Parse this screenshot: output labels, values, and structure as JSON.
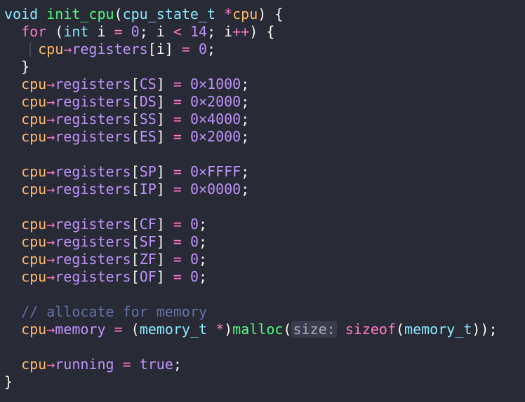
{
  "code": {
    "lines": [
      {
        "indent": "",
        "tokens": [
          {
            "t": "void",
            "k": "type"
          },
          {
            "t": " ",
            "k": "punct"
          },
          {
            "t": "init_cpu",
            "k": "fn"
          },
          {
            "t": "(",
            "k": "punct"
          },
          {
            "t": "cpu_state_t",
            "k": "type"
          },
          {
            "t": " ",
            "k": "punct"
          },
          {
            "t": "*",
            "k": "op"
          },
          {
            "t": "cpu",
            "k": "var"
          },
          {
            "t": ") {",
            "k": "punct"
          }
        ]
      },
      {
        "indent": "  ",
        "tokens": [
          {
            "t": "for",
            "k": "kw"
          },
          {
            "t": " (",
            "k": "punct"
          },
          {
            "t": "int",
            "k": "type"
          },
          {
            "t": " i ",
            "k": "punct"
          },
          {
            "t": "=",
            "k": "op"
          },
          {
            "t": " ",
            "k": "punct"
          },
          {
            "t": "0",
            "k": "num"
          },
          {
            "t": "; i ",
            "k": "punct"
          },
          {
            "t": "<",
            "k": "op"
          },
          {
            "t": " ",
            "k": "punct"
          },
          {
            "t": "14",
            "k": "num"
          },
          {
            "t": "; i",
            "k": "punct"
          },
          {
            "t": "++",
            "k": "op"
          },
          {
            "t": ") {",
            "k": "punct"
          }
        ]
      },
      {
        "indent": "    ",
        "guide": true,
        "tokens": [
          {
            "t": "cpu",
            "k": "var"
          },
          {
            "t": "→",
            "k": "op"
          },
          {
            "t": "registers",
            "k": "field"
          },
          {
            "t": "[i] ",
            "k": "punct"
          },
          {
            "t": "=",
            "k": "op"
          },
          {
            "t": " ",
            "k": "punct"
          },
          {
            "t": "0",
            "k": "num"
          },
          {
            "t": ";",
            "k": "punct"
          }
        ]
      },
      {
        "indent": "  ",
        "tokens": [
          {
            "t": "}",
            "k": "punct"
          }
        ]
      },
      {
        "indent": "  ",
        "tokens": [
          {
            "t": "cpu",
            "k": "var"
          },
          {
            "t": "→",
            "k": "op"
          },
          {
            "t": "registers",
            "k": "field"
          },
          {
            "t": "[",
            "k": "punct"
          },
          {
            "t": "CS",
            "k": "field"
          },
          {
            "t": "] ",
            "k": "punct"
          },
          {
            "t": "=",
            "k": "op"
          },
          {
            "t": " ",
            "k": "punct"
          },
          {
            "t": "0×1000",
            "k": "num"
          },
          {
            "t": ";",
            "k": "punct"
          }
        ]
      },
      {
        "indent": "  ",
        "tokens": [
          {
            "t": "cpu",
            "k": "var"
          },
          {
            "t": "→",
            "k": "op"
          },
          {
            "t": "registers",
            "k": "field"
          },
          {
            "t": "[",
            "k": "punct"
          },
          {
            "t": "DS",
            "k": "field"
          },
          {
            "t": "] ",
            "k": "punct"
          },
          {
            "t": "=",
            "k": "op"
          },
          {
            "t": " ",
            "k": "punct"
          },
          {
            "t": "0×2000",
            "k": "num"
          },
          {
            "t": ";",
            "k": "punct"
          }
        ]
      },
      {
        "indent": "  ",
        "tokens": [
          {
            "t": "cpu",
            "k": "var"
          },
          {
            "t": "→",
            "k": "op"
          },
          {
            "t": "registers",
            "k": "field"
          },
          {
            "t": "[",
            "k": "punct"
          },
          {
            "t": "SS",
            "k": "field"
          },
          {
            "t": "] ",
            "k": "punct"
          },
          {
            "t": "=",
            "k": "op"
          },
          {
            "t": " ",
            "k": "punct"
          },
          {
            "t": "0×4000",
            "k": "num"
          },
          {
            "t": ";",
            "k": "punct"
          }
        ]
      },
      {
        "indent": "  ",
        "tokens": [
          {
            "t": "cpu",
            "k": "var"
          },
          {
            "t": "→",
            "k": "op"
          },
          {
            "t": "registers",
            "k": "field"
          },
          {
            "t": "[",
            "k": "punct"
          },
          {
            "t": "ES",
            "k": "field"
          },
          {
            "t": "] ",
            "k": "punct"
          },
          {
            "t": "=",
            "k": "op"
          },
          {
            "t": " ",
            "k": "punct"
          },
          {
            "t": "0×2000",
            "k": "num"
          },
          {
            "t": ";",
            "k": "punct"
          }
        ]
      },
      {
        "indent": "",
        "tokens": []
      },
      {
        "indent": "  ",
        "tokens": [
          {
            "t": "cpu",
            "k": "var"
          },
          {
            "t": "→",
            "k": "op"
          },
          {
            "t": "registers",
            "k": "field"
          },
          {
            "t": "[",
            "k": "punct"
          },
          {
            "t": "SP",
            "k": "field"
          },
          {
            "t": "] ",
            "k": "punct"
          },
          {
            "t": "=",
            "k": "op"
          },
          {
            "t": " ",
            "k": "punct"
          },
          {
            "t": "0×FFFF",
            "k": "num"
          },
          {
            "t": ";",
            "k": "punct"
          }
        ]
      },
      {
        "indent": "  ",
        "tokens": [
          {
            "t": "cpu",
            "k": "var"
          },
          {
            "t": "→",
            "k": "op"
          },
          {
            "t": "registers",
            "k": "field"
          },
          {
            "t": "[",
            "k": "punct"
          },
          {
            "t": "IP",
            "k": "field"
          },
          {
            "t": "] ",
            "k": "punct"
          },
          {
            "t": "=",
            "k": "op"
          },
          {
            "t": " ",
            "k": "punct"
          },
          {
            "t": "0×0000",
            "k": "num"
          },
          {
            "t": ";",
            "k": "punct"
          }
        ]
      },
      {
        "indent": "",
        "tokens": []
      },
      {
        "indent": "  ",
        "tokens": [
          {
            "t": "cpu",
            "k": "var"
          },
          {
            "t": "→",
            "k": "op"
          },
          {
            "t": "registers",
            "k": "field"
          },
          {
            "t": "[",
            "k": "punct"
          },
          {
            "t": "CF",
            "k": "field"
          },
          {
            "t": "] ",
            "k": "punct"
          },
          {
            "t": "=",
            "k": "op"
          },
          {
            "t": " ",
            "k": "punct"
          },
          {
            "t": "0",
            "k": "num"
          },
          {
            "t": ";",
            "k": "punct"
          }
        ]
      },
      {
        "indent": "  ",
        "tokens": [
          {
            "t": "cpu",
            "k": "var"
          },
          {
            "t": "→",
            "k": "op"
          },
          {
            "t": "registers",
            "k": "field"
          },
          {
            "t": "[",
            "k": "punct"
          },
          {
            "t": "SF",
            "k": "field"
          },
          {
            "t": "] ",
            "k": "punct"
          },
          {
            "t": "=",
            "k": "op"
          },
          {
            "t": " ",
            "k": "punct"
          },
          {
            "t": "0",
            "k": "num"
          },
          {
            "t": ";",
            "k": "punct"
          }
        ]
      },
      {
        "indent": "  ",
        "tokens": [
          {
            "t": "cpu",
            "k": "var"
          },
          {
            "t": "→",
            "k": "op"
          },
          {
            "t": "registers",
            "k": "field"
          },
          {
            "t": "[",
            "k": "punct"
          },
          {
            "t": "ZF",
            "k": "field"
          },
          {
            "t": "] ",
            "k": "punct"
          },
          {
            "t": "=",
            "k": "op"
          },
          {
            "t": " ",
            "k": "punct"
          },
          {
            "t": "0",
            "k": "num"
          },
          {
            "t": ";",
            "k": "punct"
          }
        ]
      },
      {
        "indent": "  ",
        "tokens": [
          {
            "t": "cpu",
            "k": "var"
          },
          {
            "t": "→",
            "k": "op"
          },
          {
            "t": "registers",
            "k": "field"
          },
          {
            "t": "[",
            "k": "punct"
          },
          {
            "t": "OF",
            "k": "field"
          },
          {
            "t": "] ",
            "k": "punct"
          },
          {
            "t": "=",
            "k": "op"
          },
          {
            "t": " ",
            "k": "punct"
          },
          {
            "t": "0",
            "k": "num"
          },
          {
            "t": ";",
            "k": "punct"
          }
        ]
      },
      {
        "indent": "",
        "tokens": []
      },
      {
        "indent": "  ",
        "tokens": [
          {
            "t": "// allocate for memory",
            "k": "comment"
          }
        ]
      },
      {
        "indent": "  ",
        "tokens": [
          {
            "t": "cpu",
            "k": "var"
          },
          {
            "t": "→",
            "k": "op"
          },
          {
            "t": "memory",
            "k": "field"
          },
          {
            "t": " ",
            "k": "punct"
          },
          {
            "t": "=",
            "k": "op"
          },
          {
            "t": " (",
            "k": "punct"
          },
          {
            "t": "memory_t",
            "k": "type"
          },
          {
            "t": " ",
            "k": "punct"
          },
          {
            "t": "*",
            "k": "op"
          },
          {
            "t": ")",
            "k": "punct"
          },
          {
            "t": "malloc",
            "k": "fn"
          },
          {
            "t": "(",
            "k": "punct"
          },
          {
            "t": "size:",
            "k": "hint"
          },
          {
            "t": " ",
            "k": "punct"
          },
          {
            "t": "sizeof",
            "k": "kw"
          },
          {
            "t": "(",
            "k": "punct"
          },
          {
            "t": "memory_t",
            "k": "type"
          },
          {
            "t": "));",
            "k": "punct"
          }
        ]
      },
      {
        "indent": "",
        "tokens": []
      },
      {
        "indent": "  ",
        "tokens": [
          {
            "t": "cpu",
            "k": "var"
          },
          {
            "t": "→",
            "k": "op"
          },
          {
            "t": "running",
            "k": "field"
          },
          {
            "t": " ",
            "k": "punct"
          },
          {
            "t": "=",
            "k": "op"
          },
          {
            "t": " ",
            "k": "punct"
          },
          {
            "t": "true",
            "k": "num"
          },
          {
            "t": ";",
            "k": "punct"
          }
        ]
      },
      {
        "indent": "",
        "tokens": [
          {
            "t": "}",
            "k": "punct"
          }
        ]
      }
    ]
  },
  "colors": {
    "background": "#282a36",
    "keyword": "#ff79c6",
    "type": "#8be9fd",
    "function": "#50fa7b",
    "variable": "#ffb86c",
    "field": "#bd93f9",
    "comment": "#6272a4"
  }
}
